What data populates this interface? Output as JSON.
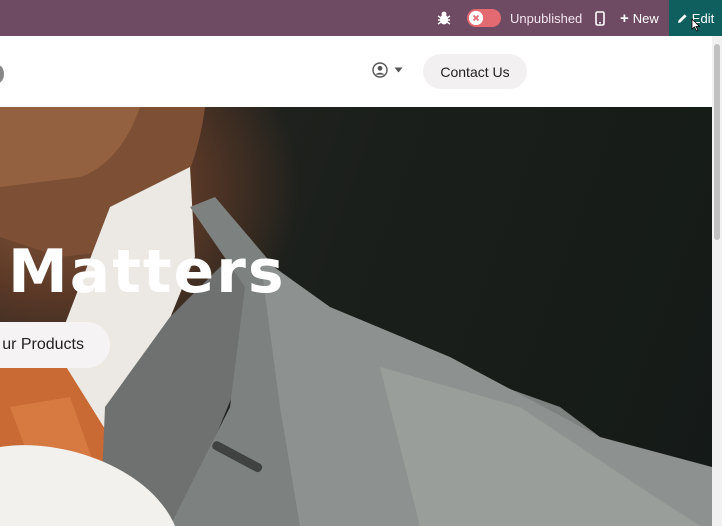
{
  "topbar": {
    "status_label": "Unpublished",
    "new_label": "New",
    "edit_label": "Edit",
    "colors": {
      "bar": "#6f4a63",
      "edit": "#0f5f5f",
      "toggle": "#e46a72"
    },
    "icons": [
      "bug-icon",
      "toggle-x-icon",
      "mobile-icon",
      "plus-icon",
      "pencil-icon"
    ]
  },
  "header": {
    "contact_label": "Contact Us",
    "icons": [
      "user-circle-icon",
      "caret-down-icon"
    ]
  },
  "hero": {
    "title": "Matters",
    "cta_label": "ur Products"
  }
}
